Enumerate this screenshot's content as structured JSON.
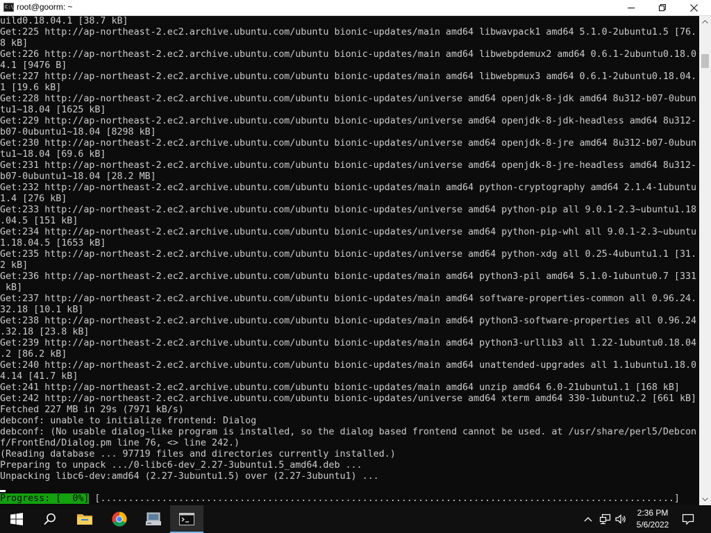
{
  "window": {
    "title": "root@goorm: ~"
  },
  "terminal": {
    "lines": [
      "uild0.18.04.1 [38.7 kB]",
      "Get:225 http://ap-northeast-2.ec2.archive.ubuntu.com/ubuntu bionic-updates/main amd64 libwavpack1 amd64 5.1.0-2ubuntu1.5 [76.",
      "8 kB]",
      "Get:226 http://ap-northeast-2.ec2.archive.ubuntu.com/ubuntu bionic-updates/main amd64 libwebpdemux2 amd64 0.6.1-2ubuntu0.18.0",
      "4.1 [9476 B]",
      "Get:227 http://ap-northeast-2.ec2.archive.ubuntu.com/ubuntu bionic-updates/main amd64 libwebpmux3 amd64 0.6.1-2ubuntu0.18.04.",
      "1 [19.6 kB]",
      "Get:228 http://ap-northeast-2.ec2.archive.ubuntu.com/ubuntu bionic-updates/universe amd64 openjdk-8-jdk amd64 8u312-b07-0ubun",
      "tu1~18.04 [1625 kB]",
      "Get:229 http://ap-northeast-2.ec2.archive.ubuntu.com/ubuntu bionic-updates/universe amd64 openjdk-8-jdk-headless amd64 8u312-",
      "b07-0ubuntu1~18.04 [8298 kB]",
      "Get:230 http://ap-northeast-2.ec2.archive.ubuntu.com/ubuntu bionic-updates/universe amd64 openjdk-8-jre amd64 8u312-b07-0ubun",
      "tu1~18.04 [69.6 kB]",
      "Get:231 http://ap-northeast-2.ec2.archive.ubuntu.com/ubuntu bionic-updates/universe amd64 openjdk-8-jre-headless amd64 8u312-",
      "b07-0ubuntu1~18.04 [28.2 MB]",
      "Get:232 http://ap-northeast-2.ec2.archive.ubuntu.com/ubuntu bionic-updates/main amd64 python-cryptography amd64 2.1.4-1ubuntu",
      "1.4 [276 kB]",
      "Get:233 http://ap-northeast-2.ec2.archive.ubuntu.com/ubuntu bionic-updates/universe amd64 python-pip all 9.0.1-2.3~ubuntu1.18",
      ".04.5 [151 kB]",
      "Get:234 http://ap-northeast-2.ec2.archive.ubuntu.com/ubuntu bionic-updates/universe amd64 python-pip-whl all 9.0.1-2.3~ubuntu",
      "1.18.04.5 [1653 kB]",
      "Get:235 http://ap-northeast-2.ec2.archive.ubuntu.com/ubuntu bionic-updates/universe amd64 python-xdg all 0.25-4ubuntu1.1 [31.",
      "2 kB]",
      "Get:236 http://ap-northeast-2.ec2.archive.ubuntu.com/ubuntu bionic-updates/main amd64 python3-pil amd64 5.1.0-1ubuntu0.7 [331",
      " kB]",
      "Get:237 http://ap-northeast-2.ec2.archive.ubuntu.com/ubuntu bionic-updates/main amd64 software-properties-common all 0.96.24.",
      "32.18 [10.1 kB]",
      "Get:238 http://ap-northeast-2.ec2.archive.ubuntu.com/ubuntu bionic-updates/main amd64 python3-software-properties all 0.96.24",
      ".32.18 [23.8 kB]",
      "Get:239 http://ap-northeast-2.ec2.archive.ubuntu.com/ubuntu bionic-updates/main amd64 python3-urllib3 all 1.22-1ubuntu0.18.04",
      ".2 [86.2 kB]",
      "Get:240 http://ap-northeast-2.ec2.archive.ubuntu.com/ubuntu bionic-updates/main amd64 unattended-upgrades all 1.1ubuntu1.18.0",
      "4.14 [41.7 kB]",
      "Get:241 http://ap-northeast-2.ec2.archive.ubuntu.com/ubuntu bionic-updates/main amd64 unzip amd64 6.0-21ubuntu1.1 [168 kB]",
      "Get:242 http://ap-northeast-2.ec2.archive.ubuntu.com/ubuntu bionic-updates/universe amd64 xterm amd64 330-1ubuntu2.2 [661 kB]",
      "Fetched 227 MB in 29s (7971 kB/s)",
      "debconf: unable to initialize frontend: Dialog",
      "debconf: (No usable dialog-like program is installed, so the dialog based frontend cannot be used. at /usr/share/perl5/Debcon",
      "f/FrontEnd/Dialog.pm line 76, <> line 242.)",
      "(Reading database ... 97719 files and directories currently installed.)",
      "Preparing to unpack .../0-libc6-dev_2.27-3ubuntu1.5_amd64.deb ...",
      "Unpacking libc6-dev:amd64 (2.27-3ubuntu1.5) over (2.27-3ubuntu1) ..."
    ],
    "progress_label": "Progress: [  0%]",
    "progress_bar": " [.......................................................................................................]",
    "progress_percent": 0
  },
  "taskbar": {
    "items": [
      {
        "name": "start-button",
        "icon": "windows-logo-icon"
      },
      {
        "name": "search-button",
        "icon": "search-icon"
      },
      {
        "name": "file-explorer",
        "icon": "folder-icon"
      },
      {
        "name": "chrome",
        "icon": "chrome-icon"
      },
      {
        "name": "server-manager",
        "icon": "server-manager-icon"
      },
      {
        "name": "command-prompt",
        "icon": "terminal-icon"
      }
    ],
    "time": "2:36 PM",
    "date": "5/6/2022"
  },
  "colors": {
    "terminal_bg": "#0c0c0c",
    "terminal_fg": "#cccccc",
    "progress_bg": "#13a10e",
    "taskbar_bg": "#101010",
    "accent": "#76b9ed"
  }
}
